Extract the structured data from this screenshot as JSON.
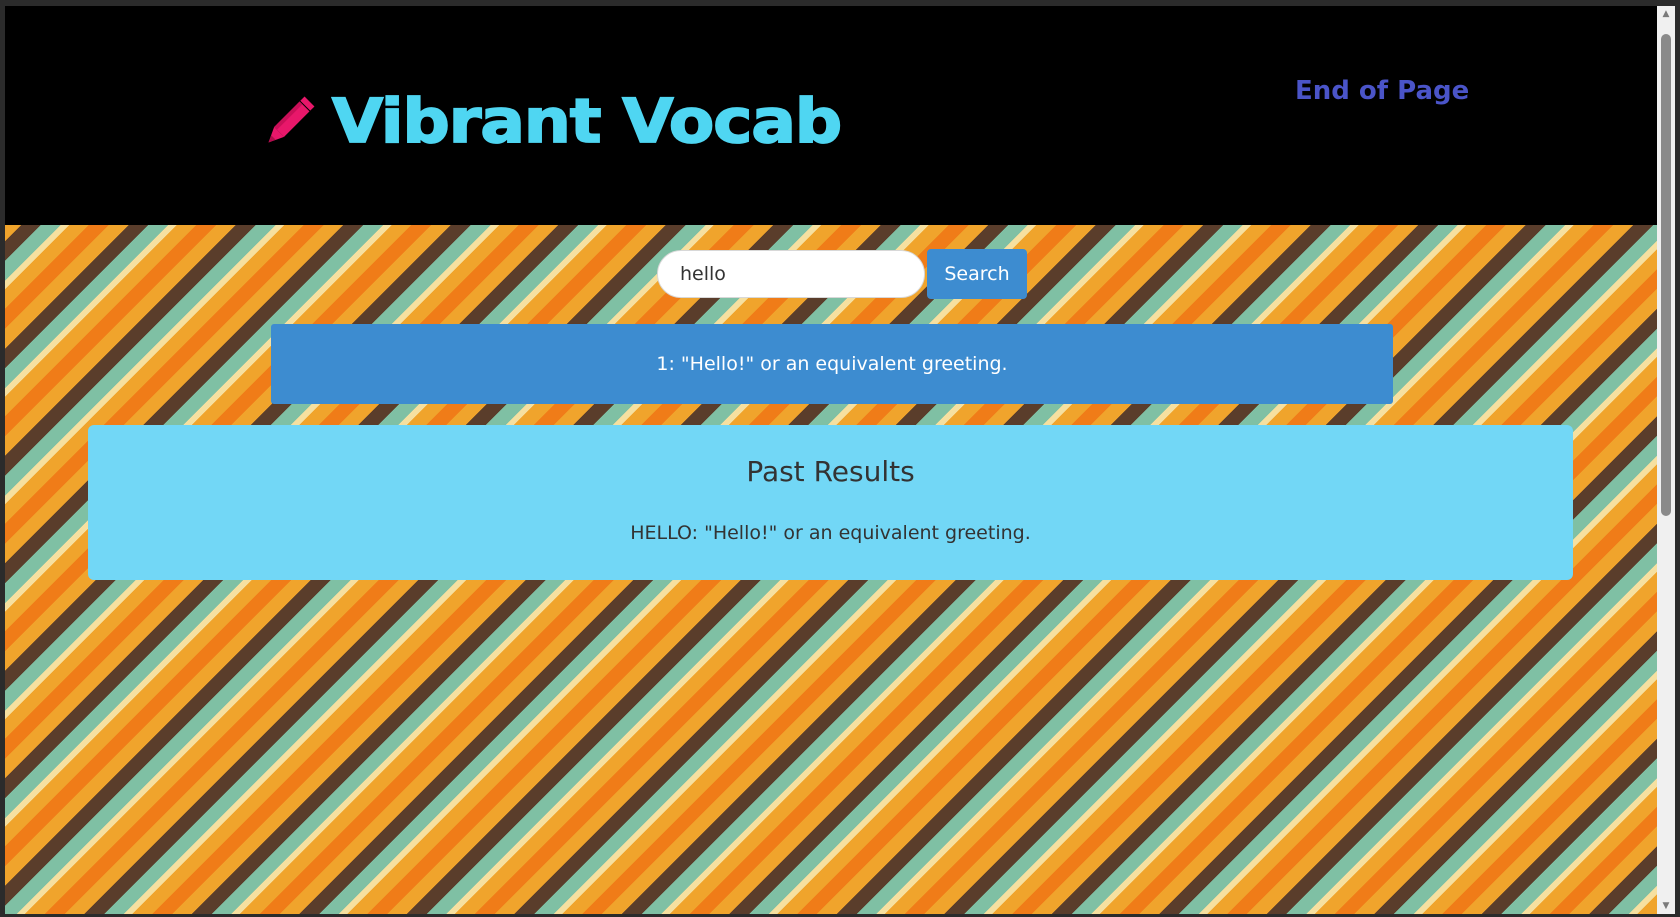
{
  "header": {
    "title": "Vibrant Vocab",
    "nav_link": "End of Page",
    "logo_icon": "pencil-icon"
  },
  "search": {
    "value": "hello",
    "button_label": "Search"
  },
  "result": {
    "text": "1: \"Hello!\" or an equivalent greeting."
  },
  "past_results": {
    "title": "Past Results",
    "items": [
      "HELLO: \"Hello!\" or an equivalent greeting."
    ]
  },
  "colors": {
    "header_bg": "#000000",
    "title": "#4fd6f2",
    "link": "#4a54c8",
    "pencil": "#e8176a",
    "result_bg": "#3d8cd0",
    "past_bg": "#72d7f6",
    "stripes": [
      "#f0a42c",
      "#f6e0a0",
      "#7fc0a4",
      "#5a3d2b",
      "#f07c18"
    ]
  }
}
